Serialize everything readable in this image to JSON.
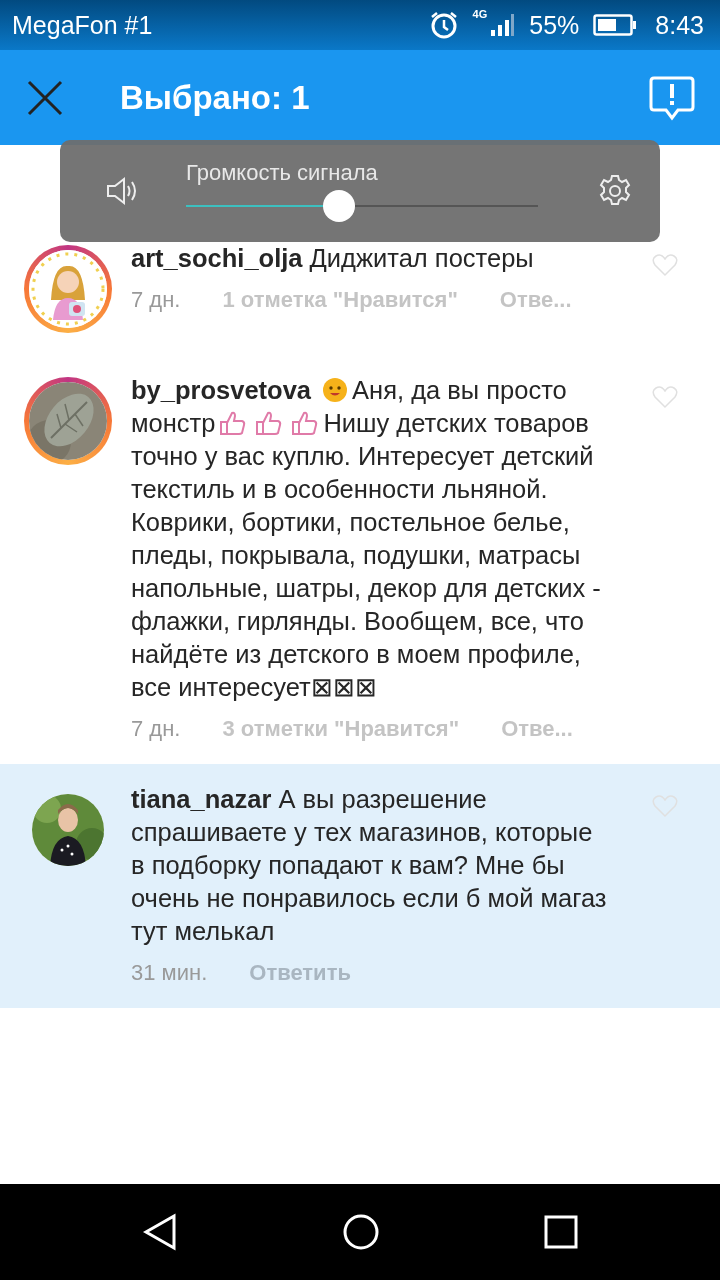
{
  "status_bar": {
    "carrier": "MegaFon #1",
    "network": "4G",
    "battery": "55%",
    "time": "8:43"
  },
  "app_bar": {
    "title": "Выбрано: 1"
  },
  "volume_popup": {
    "label": "Громкость сигнала",
    "level": 0.435
  },
  "comments": [
    {
      "highlighted": false,
      "story_ring": true,
      "username": "art_sochi_olja",
      "segments": [
        {
          "kind": "text",
          "text": "Диджитал постеры"
        }
      ],
      "time": "7 дн.",
      "likes": "1 отметка \"Нравится\"",
      "reply": "Отве..."
    },
    {
      "highlighted": false,
      "story_ring": true,
      "username": "by_prosvetova",
      "segments": [
        {
          "kind": "smile"
        },
        {
          "kind": "text",
          "text": "Аня, да вы просто монстр"
        },
        {
          "kind": "thumb"
        },
        {
          "kind": "thumb"
        },
        {
          "kind": "thumb"
        },
        {
          "kind": "text",
          "text": "Нишу детских товаров точно у вас куплю. Интересует детский текстиль и в особенности льняной. Коврики, бортики, постельное белье, пледы, покрывала, подушки, матрасы напольные, шатры, декор для детских - флажки, гирлянды. Вообщем, все, что найдёте из детского в моем профиле, все интересует⊠⊠⊠"
        }
      ],
      "time": "7 дн.",
      "likes": "3 отметки \"Нравится\"",
      "reply": "Отве..."
    },
    {
      "highlighted": true,
      "story_ring": false,
      "username": "tiana_nazar",
      "segments": [
        {
          "kind": "text",
          "text": "А вы разрешение спрашиваете у тех магазинов, которые в подборку попадают к вам? Мне бы очень не понравилось если б мой магаз тут мелькал"
        }
      ],
      "time": "31 мин.",
      "reply": "Ответить"
    }
  ]
}
